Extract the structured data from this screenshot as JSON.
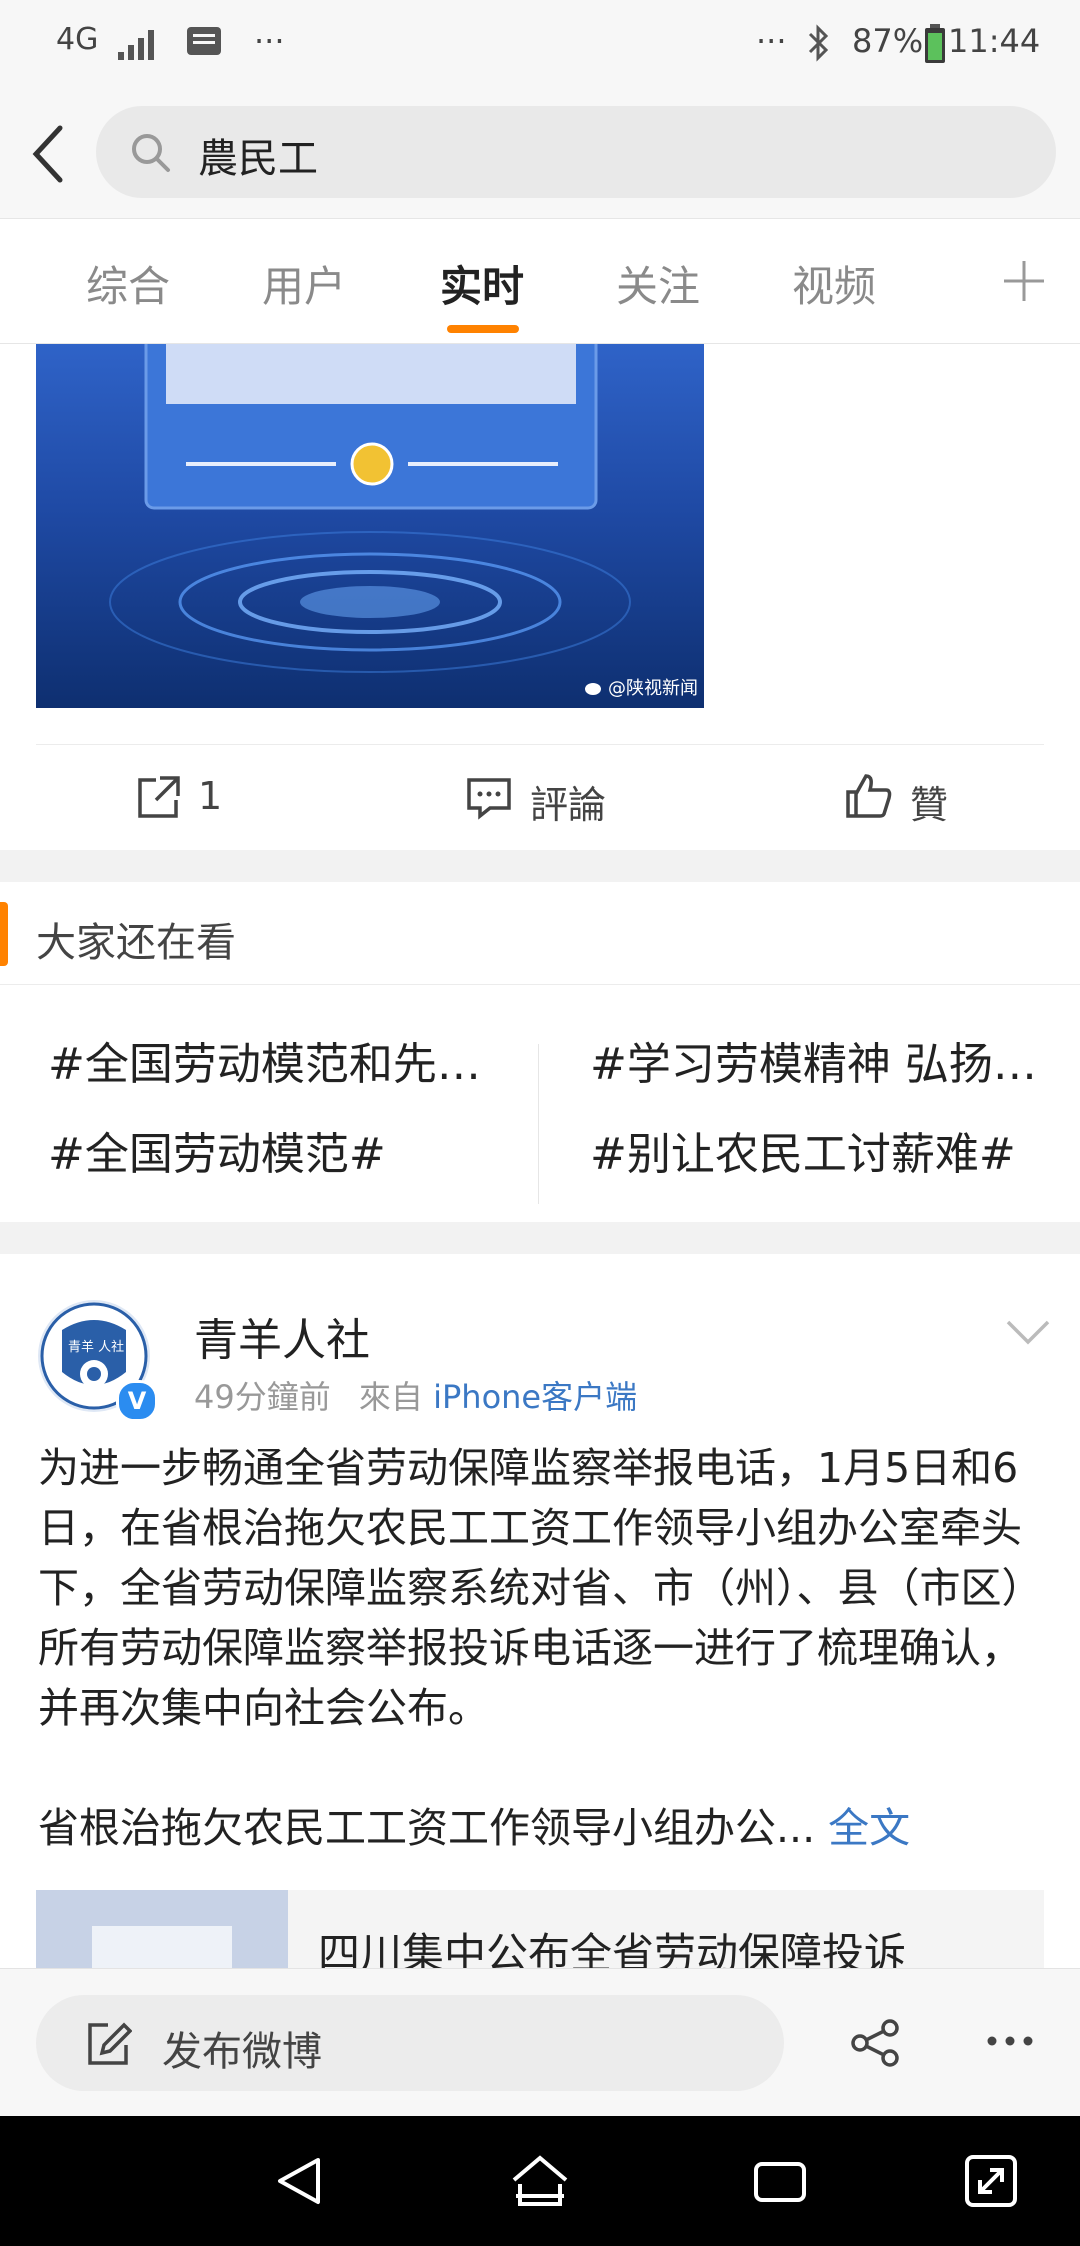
{
  "status_bar": {
    "network": "4G",
    "more_left": "···",
    "more_right": "···",
    "battery": "87%",
    "time": "11:44"
  },
  "search": {
    "query": "農民工"
  },
  "tabs": [
    {
      "label": "综合"
    },
    {
      "label": "用户"
    },
    {
      "label": "实时"
    },
    {
      "label": "关注"
    },
    {
      "label": "视频"
    }
  ],
  "post1": {
    "image_watermark": "@陕视新闻",
    "repost_count": "1",
    "comment_label": "評論",
    "like_label": "贊"
  },
  "recommend": {
    "title": "大家还在看",
    "topics": [
      "#全国劳动模范和先进工作者#",
      "#学习劳模精神 弘扬劳模精神#",
      "#全国劳动模范#",
      "#别让农民工讨薪难#"
    ]
  },
  "post2": {
    "author": "青羊人社",
    "avatar_text": "青羊 人社",
    "time": "49分鐘前",
    "source_prefix": "來自",
    "source": "iPhone客户端",
    "paragraph1": "为进一步畅通全省劳动保障监察举报电话，1月5日和6日，在省根治拖欠农民工工资工作领导小组办公室牵头下，全省劳动保障监察系统对省、市（州）、县（市区）所有劳动保障监察举报投诉电话逐一进行了梳理确认，并再次集中向社会公布。",
    "paragraph2": "省根治拖欠农民工工资工作领导小组办公...",
    "full_text_label": "全文",
    "link_title": "四川集中公布全省劳动保障投诉"
  },
  "bottom_bar": {
    "compose_label": "发布微博"
  },
  "colors": {
    "accent": "#ff8200",
    "link": "#3b78c4",
    "verified": "#2b8cf0"
  }
}
